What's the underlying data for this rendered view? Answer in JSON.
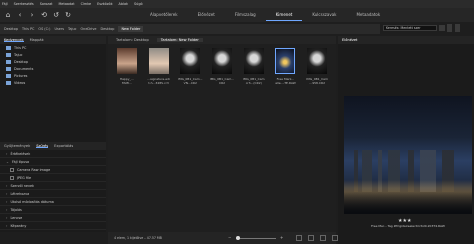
{
  "menu": [
    "Fájl",
    "Szerkesztés",
    "Sorozat",
    "Metaadat",
    "Címke",
    "Eszközök",
    "Ablak",
    "Súgó"
  ],
  "toolbar": {
    "icons": [
      "home-icon",
      "back-icon",
      "forward-icon",
      "recent-icon",
      "rotate-ccw-icon",
      "rotate-cw-icon"
    ]
  },
  "modes": [
    "Alapvetőlerek",
    "Előnézet",
    "Filmszalag",
    "Kimenet",
    "Kulcsszavak",
    "Metaadatok"
  ],
  "active_mode_index": 3,
  "path": [
    "Desktop",
    "This PC",
    "OS (C:)",
    "Users",
    "Tajuc",
    "OneDrive",
    "Desktop",
    "New Folder"
  ],
  "search": {
    "value": "Keresés: Mentett szer"
  },
  "left": {
    "tabs": [
      "Kedvencek",
      "Mappák"
    ],
    "active_tab": 0,
    "items": [
      "This PC",
      "Tajuc",
      "Desktop",
      "Documents",
      "Pictures",
      "Videos"
    ]
  },
  "filter": {
    "tabs": [
      "Gyűjtemények",
      "Szűrés",
      "Exportálás"
    ],
    "active_tab": 1,
    "rows": [
      {
        "label": "Értékelések",
        "type": "header"
      },
      {
        "label": "Fájl típusa",
        "type": "header"
      },
      {
        "label": "Camera Raw image",
        "type": "check"
      },
      {
        "label": "JPEG file",
        "type": "check"
      },
      {
        "label": "Szerzői nevek",
        "type": "header"
      },
      {
        "label": "Létrehozva",
        "type": "header"
      },
      {
        "label": "Utolsó módosítás dátuma",
        "type": "header"
      },
      {
        "label": "Tájolás",
        "type": "header"
      },
      {
        "label": "Lencse",
        "type": "header"
      },
      {
        "label": "Képarány",
        "type": "header"
      }
    ]
  },
  "content": {
    "tabs": [
      "Tartalom: Desktop",
      "Tartalom: New Folder"
    ],
    "active_tab": 1,
    "thumbnails": [
      {
        "label": "Happy_...\nFAMI...",
        "style": "portrait1"
      },
      {
        "label": "...signature-edi\nt-h...348S.cr3",
        "style": "portrait2"
      },
      {
        "label": "IMG_0B1_Cam...\nVN...CR2",
        "style": "dark"
      },
      {
        "label": "IMG_0B1_Cam...\nCR2",
        "style": "dark"
      },
      {
        "label": "IMG_0B1_Cam\ncr3...(CR2)",
        "style": "dark"
      },
      {
        "label": "Free Mark...\nalle...-TE.RAW",
        "style": "sel"
      },
      {
        "label": "IMG_0B1_Cam\n...958.CR2",
        "style": "dark"
      }
    ],
    "status": "4 elem, 1 kijelölve – 47.57 MB"
  },
  "right": {
    "title": "Előnézet",
    "stars": "★★★",
    "caption": "Free Mar... Tag #frigidaireelectricSU0.203T4.RAW"
  }
}
